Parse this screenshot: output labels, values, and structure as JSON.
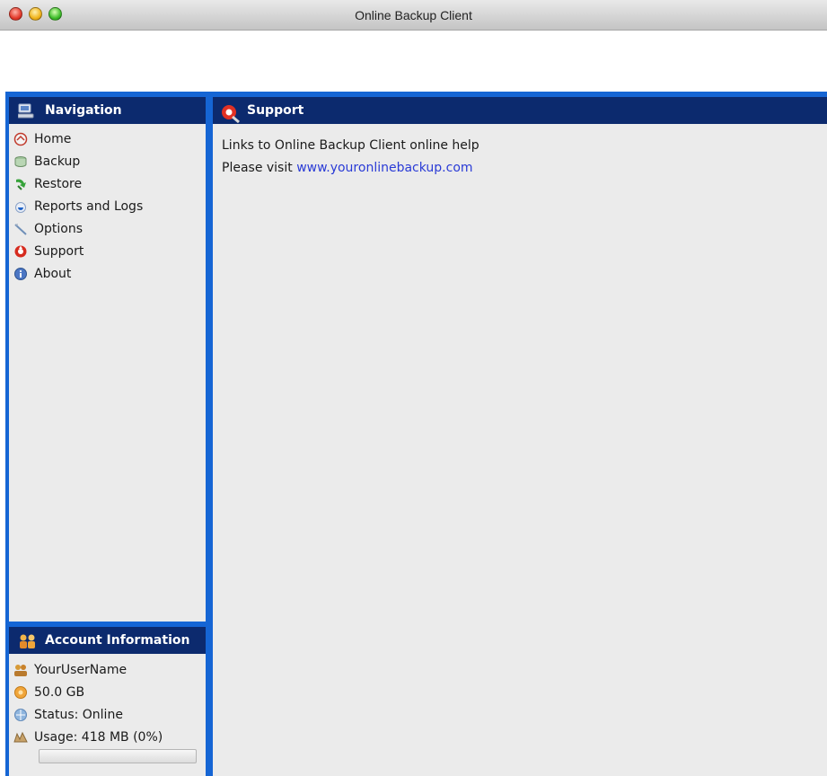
{
  "window": {
    "title": "Online Backup Client"
  },
  "navigation": {
    "header": "Navigation",
    "items": [
      {
        "label": "Home",
        "icon": "home-icon"
      },
      {
        "label": "Backup",
        "icon": "backup-icon"
      },
      {
        "label": "Restore",
        "icon": "restore-icon"
      },
      {
        "label": "Reports and Logs",
        "icon": "reports-icon"
      },
      {
        "label": "Options",
        "icon": "options-icon"
      },
      {
        "label": "Support",
        "icon": "support-icon"
      },
      {
        "label": "About",
        "icon": "about-icon"
      }
    ]
  },
  "account": {
    "header": "Account Information",
    "username": "YourUserName",
    "quota": "50.0 GB",
    "status": "Status: Online",
    "usage": "Usage: 418 MB (0%)",
    "usage_fraction": 0
  },
  "support": {
    "header": "Support",
    "line1": "Links to Online Backup Client online help",
    "visit_prefix": "Please visit",
    "link": "www.youronlinebackup.com"
  },
  "colors": {
    "frame": "#1565d4",
    "header": "#0c2a6e",
    "panel": "#ebebeb",
    "link": "#2a3bd6"
  }
}
